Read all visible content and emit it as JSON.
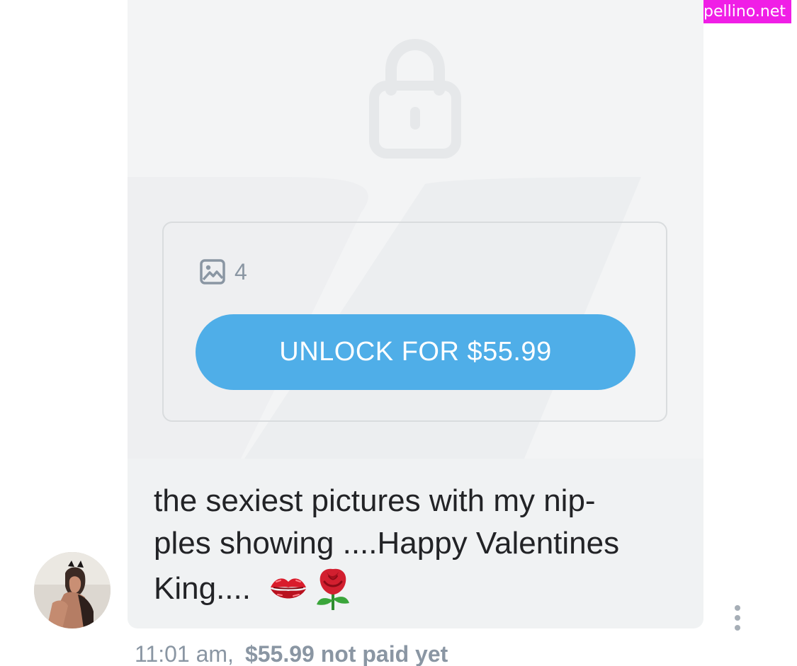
{
  "watermark": {
    "text": "fapellino.net"
  },
  "locked_message": {
    "lock_icon": "lock-icon",
    "media_icon": "image-icon",
    "media_count": "4",
    "unlock_button_label": "UNLOCK FOR $55.99"
  },
  "message": {
    "text": "the sexiest pictures with my nip-ples showing ....Happy Valentines King....",
    "line1": "the sexiest pictures with my nip-",
    "line2": "ples showing ....Happy Valentines",
    "line3": "King....",
    "emojis": [
      "kiss-mark-icon",
      "rose-icon"
    ]
  },
  "meta": {
    "time": "11:01 am,",
    "price": "$55.99",
    "status": "not paid yet"
  },
  "avatar": {
    "icon": "avatar"
  },
  "actions": {
    "more_icon": "more-vertical-icon"
  },
  "colors": {
    "accent_button": "#4faee8",
    "text_primary": "#222326",
    "text_secondary": "#8a96a3",
    "bubble_background": "#f0f2f3",
    "watermark_background": "#f01ee6"
  }
}
